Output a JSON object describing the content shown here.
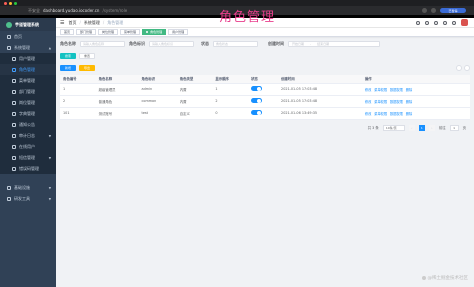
{
  "browser": {
    "security_label": "不安全",
    "host": "dashboard.yudao.iocoder.cn",
    "path": "/system/role",
    "profile_label": "已暂停"
  },
  "sidebar": {
    "brand": "芋道管理系统",
    "items": [
      {
        "label": "首页"
      },
      {
        "label": "系统管理",
        "expanded": true
      }
    ],
    "sub_items": [
      {
        "label": "用户管理"
      },
      {
        "label": "角色管理",
        "active": true
      },
      {
        "label": "菜单管理"
      },
      {
        "label": "部门管理"
      },
      {
        "label": "岗位管理"
      },
      {
        "label": "字典管理"
      },
      {
        "label": "通知公告"
      },
      {
        "label": "审计日志"
      },
      {
        "label": "在线用户"
      },
      {
        "label": "短信管理"
      },
      {
        "label": "错误码管理"
      }
    ],
    "bottom_items": [
      {
        "label": "基础设施"
      },
      {
        "label": "研发工具"
      }
    ]
  },
  "navbar": {
    "breadcrumb": [
      "首页",
      "系统管理",
      "角色管理"
    ],
    "hero_title": "角色管理"
  },
  "tags": [
    {
      "label": "首页"
    },
    {
      "label": "部门管理"
    },
    {
      "label": "岗位管理"
    },
    {
      "label": "菜单管理"
    },
    {
      "label": "角色管理",
      "active": true
    },
    {
      "label": "用户管理"
    }
  ],
  "filters": {
    "name_label": "角色名称",
    "name_placeholder": "请输入角色名称",
    "code_label": "角色标识",
    "code_placeholder": "请输入角色标识",
    "status_label": "状态",
    "status_placeholder": "角色状态",
    "time_label": "创建时间",
    "start_placeholder": "开始日期",
    "end_placeholder": "结束日期",
    "search_button": "搜索",
    "reset_button": "重置"
  },
  "actions": {
    "add": "新增",
    "export": "导出"
  },
  "table": {
    "headers": [
      "角色编号",
      "角色名称",
      "角色标识",
      "角色类型",
      "显示顺序",
      "状态",
      "创建时间",
      "操作"
    ],
    "rows": [
      {
        "id": "1",
        "name": "超级管理员",
        "code": "admin",
        "type": "内置",
        "sort": "1",
        "status": true,
        "created": "2021-01-05 17:03:48"
      },
      {
        "id": "2",
        "name": "普通角色",
        "code": "common",
        "type": "内置",
        "sort": "2",
        "status": true,
        "created": "2021-01-05 17:03:48"
      },
      {
        "id": "101",
        "name": "测试账号",
        "code": "test",
        "type": "自定义",
        "sort": "0",
        "status": true,
        "created": "2021-01-06 13:49:35"
      }
    ],
    "ops": [
      "修改",
      "菜单权限",
      "数据权限",
      "删除"
    ]
  },
  "pager": {
    "total": "共 3 条",
    "size": "10条/页",
    "current": "1",
    "jump_prefix": "前往",
    "jump_value": "1",
    "jump_suffix": "页"
  },
  "watermark": "@稀土掘金技术社区"
}
